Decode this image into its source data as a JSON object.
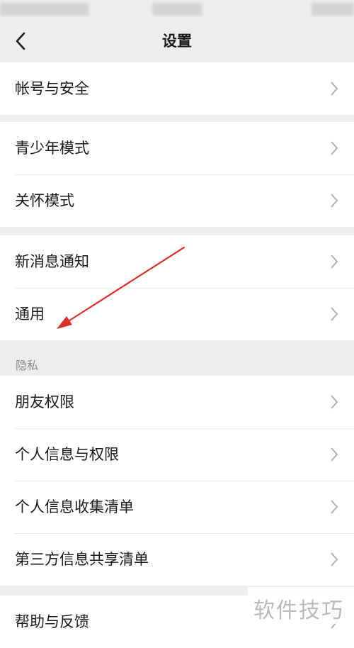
{
  "nav": {
    "title": "设置"
  },
  "groups": {
    "account": [
      "帐号与安全"
    ],
    "modes": [
      "青少年模式",
      "关怀模式"
    ],
    "notify": [
      "新消息通知",
      "通用"
    ],
    "privacy": {
      "header": "隐私",
      "items": [
        "朋友权限",
        "个人信息与权限",
        "个人信息收集清单",
        "第三方信息共享清单"
      ]
    },
    "help": [
      "帮助与反馈"
    ]
  },
  "watermark": "软件技巧",
  "colors": {
    "background": "#ededed",
    "card": "#ffffff",
    "arrow": "#d9302a",
    "chevron": "#b2b2b2"
  }
}
